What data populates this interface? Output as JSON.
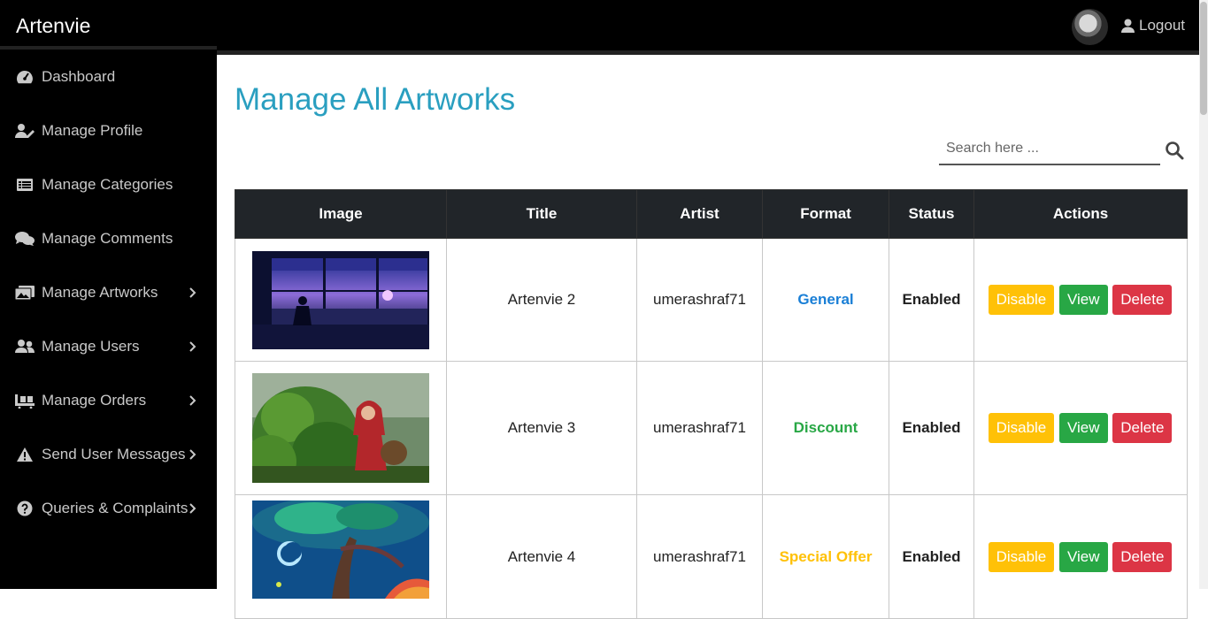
{
  "brand": "Artenvie",
  "sidebar": {
    "items": [
      {
        "label": "Dashboard",
        "has_sub": false
      },
      {
        "label": "Manage Profile",
        "has_sub": false
      },
      {
        "label": "Manage Categories",
        "has_sub": false
      },
      {
        "label": "Manage Comments",
        "has_sub": false
      },
      {
        "label": "Manage Artworks",
        "has_sub": true
      },
      {
        "label": "Manage Users",
        "has_sub": true
      },
      {
        "label": "Manage Orders",
        "has_sub": true
      },
      {
        "label": "Send User Messages",
        "has_sub": true
      },
      {
        "label": "Queries & Complaints",
        "has_sub": true
      }
    ]
  },
  "topbar": {
    "logout_label": "Logout"
  },
  "page": {
    "title": "Manage All Artworks"
  },
  "search": {
    "placeholder": "Search here ..."
  },
  "table": {
    "headers": [
      "Image",
      "Title",
      "Artist",
      "Format",
      "Status",
      "Actions"
    ],
    "rows": [
      {
        "title": "Artenvie 2",
        "artist": "umerashraf71",
        "format": "General",
        "format_color": "#1a7fd6",
        "status": "Enabled"
      },
      {
        "title": "Artenvie 3",
        "artist": "umerashraf71",
        "format": "Discount",
        "format_color": "#28a745",
        "status": "Enabled"
      },
      {
        "title": "Artenvie 4",
        "artist": "umerashraf71",
        "format": "Special Offer",
        "format_color": "#ffc107",
        "status": "Enabled"
      }
    ],
    "actions": {
      "disable": "Disable",
      "view": "View",
      "delete": "Delete"
    }
  },
  "colors": {
    "accent": "#2a9fc0",
    "sidebar_bg": "#000000",
    "table_head_bg": "#212529"
  }
}
